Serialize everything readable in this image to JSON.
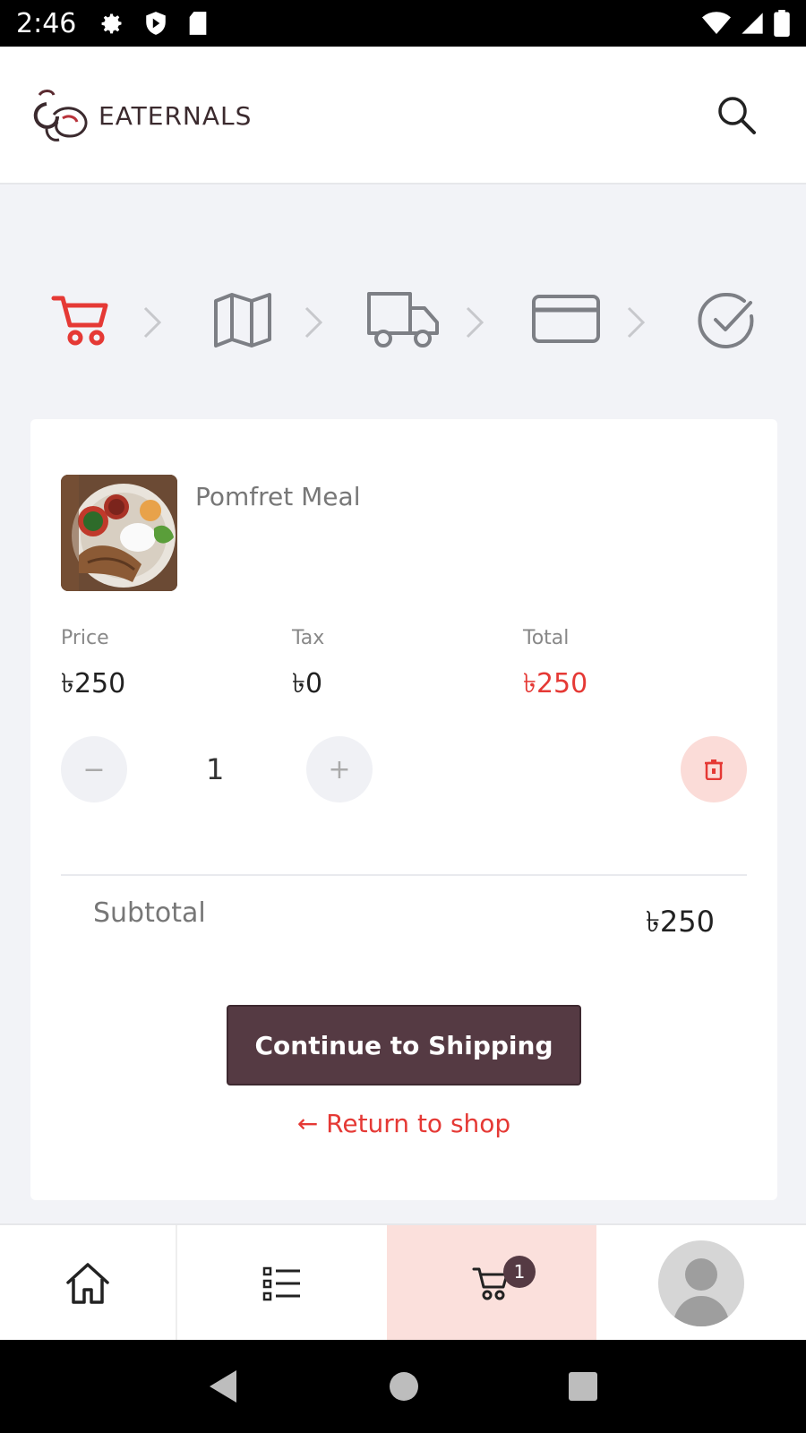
{
  "status_bar": {
    "time": "2:46",
    "left_icons": [
      "gear-icon",
      "play-shield-icon",
      "sd-card-icon"
    ],
    "right_icons": [
      "wifi-icon",
      "cell-signal-icon",
      "battery-icon"
    ]
  },
  "header": {
    "logo_text": "EATERNALS",
    "search_icon": "search-icon"
  },
  "checkout_steps": [
    {
      "name": "cart",
      "icon": "cart-icon",
      "active": true
    },
    {
      "name": "address",
      "icon": "map-icon",
      "active": false
    },
    {
      "name": "shipping",
      "icon": "truck-icon",
      "active": false
    },
    {
      "name": "payment",
      "icon": "credit-card-icon",
      "active": false
    },
    {
      "name": "confirm",
      "icon": "check-circle-icon",
      "active": false
    }
  ],
  "cart_item": {
    "name": "Pomfret Meal",
    "price_label": "Price",
    "price_value": "৳250",
    "tax_label": "Tax",
    "tax_value": "৳0",
    "total_label": "Total",
    "total_value": "৳250",
    "quantity": "1",
    "decrement_label": "−",
    "increment_label": "+"
  },
  "summary": {
    "subtotal_label": "Subtotal",
    "subtotal_value": "৳250"
  },
  "actions": {
    "continue_label": "Continue to Shipping",
    "return_label": "← Return to shop"
  },
  "bottom_nav": {
    "items": [
      {
        "name": "home",
        "icon": "home-icon"
      },
      {
        "name": "categories",
        "icon": "list-icon"
      },
      {
        "name": "cart",
        "icon": "cart-icon",
        "active": true
      },
      {
        "name": "profile",
        "icon": "avatar-icon"
      }
    ],
    "cart_badge": "1"
  },
  "colors": {
    "accent": "#e53935",
    "primary": "#553a43",
    "background": "#f2f3f7",
    "active_nav_bg": "#fbe0dc"
  }
}
